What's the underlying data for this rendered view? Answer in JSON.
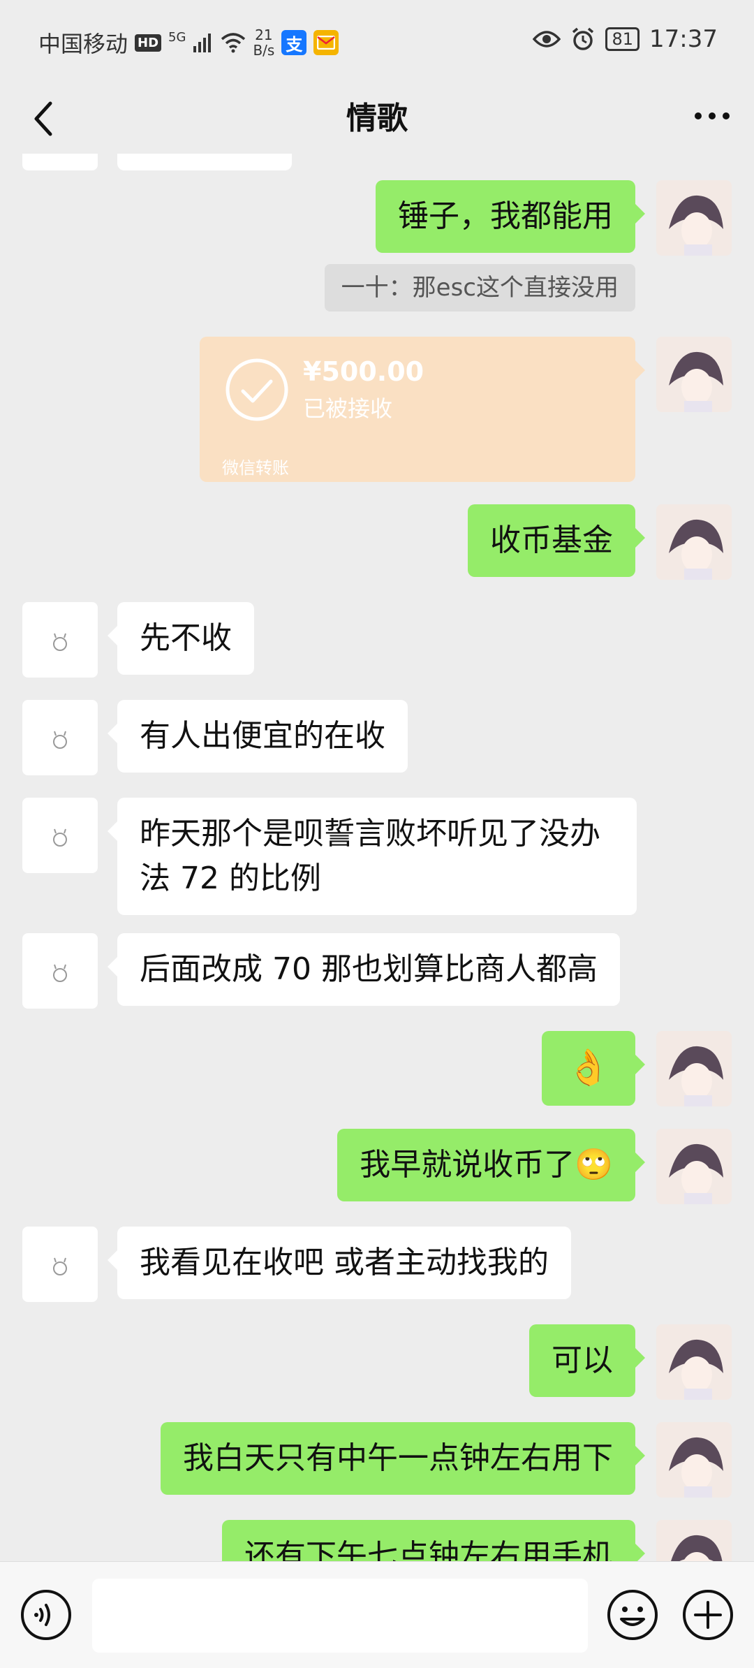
{
  "status": {
    "carrier": "中国移动",
    "hd": "HD",
    "net": "5G",
    "speed_value": "21",
    "speed_unit": "B/s",
    "alipay_icon": "支",
    "battery": "81",
    "time": "17:37"
  },
  "nav": {
    "title": "情歌"
  },
  "messages": [
    {
      "side": "me",
      "text": "锤子，我都能用"
    },
    {
      "side": "quote",
      "text": "一十：那esc这个直接没用"
    },
    {
      "side": "transfer",
      "amount": "¥500.00",
      "status": "已被接收",
      "footer": "微信转账"
    },
    {
      "side": "me",
      "text": "收币基金"
    },
    {
      "side": "other",
      "text": "先不收"
    },
    {
      "side": "other",
      "text": "有人出便宜的在收"
    },
    {
      "side": "other",
      "text": "昨天那个是呗誓言败坏听见了没办",
      "text2": "法 72 的比例"
    },
    {
      "side": "other",
      "text": "后面改成 70 那也划算比商人都高"
    },
    {
      "side": "me",
      "text": "👌"
    },
    {
      "side": "me",
      "text": "我早就说收币了🙄"
    },
    {
      "side": "other",
      "text": "我看见在收吧 或者主动找我的"
    },
    {
      "side": "me",
      "text": "可以"
    },
    {
      "side": "me",
      "text": "我白天只有中午一点钟左右用下"
    },
    {
      "side": "me",
      "text": "还有下午七点钟左右用手机"
    }
  ],
  "icons": {
    "back": "chevron-left-icon",
    "more": "more-dots-icon",
    "voice": "voice-icon",
    "emoji": "emoji-icon",
    "plus": "plus-icon"
  },
  "colors": {
    "my_bubble": "#95ec69",
    "other_bubble": "#ffffff",
    "transfer": "#fae0c3",
    "background": "#ededed"
  }
}
